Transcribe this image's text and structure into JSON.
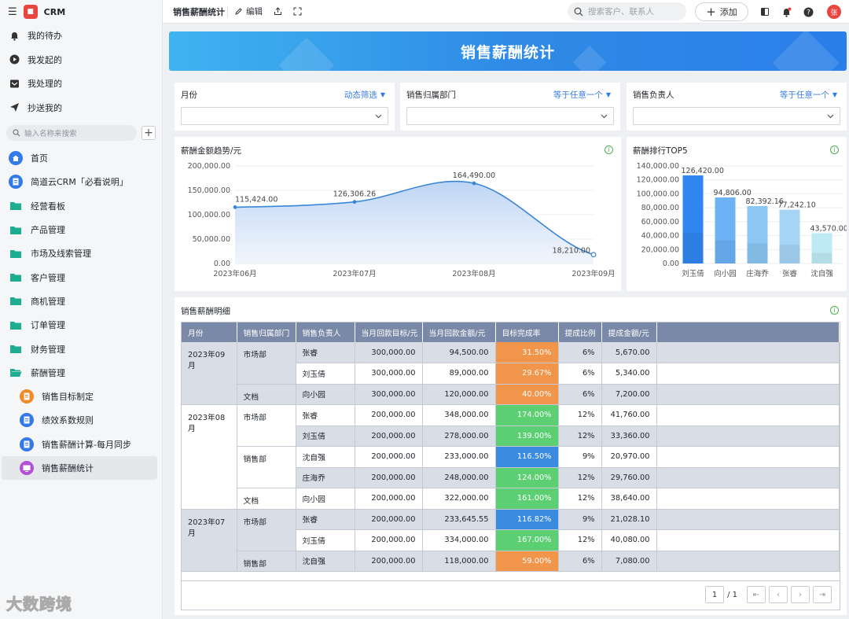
{
  "app": {
    "name": "CRM",
    "logo_color": "#e9453f"
  },
  "sidebar": {
    "quick": [
      {
        "label": "我的待办",
        "icon": "bell-icon"
      },
      {
        "label": "我发起的",
        "icon": "play-icon"
      },
      {
        "label": "我处理的",
        "icon": "inbox-icon"
      },
      {
        "label": "抄送我的",
        "icon": "send-icon"
      }
    ],
    "search_placeholder": "输入名称来搜索",
    "nav": [
      {
        "label": "首页",
        "icon": "home-icon"
      },
      {
        "label": "简道云CRM「必看说明」",
        "icon": "doc-icon"
      },
      {
        "label": "经营看板",
        "icon": "folder-icon"
      },
      {
        "label": "产品管理",
        "icon": "folder-icon"
      },
      {
        "label": "市场及线索管理",
        "icon": "folder-icon"
      },
      {
        "label": "客户管理",
        "icon": "folder-icon"
      },
      {
        "label": "商机管理",
        "icon": "folder-icon"
      },
      {
        "label": "订单管理",
        "icon": "folder-icon"
      },
      {
        "label": "财务管理",
        "icon": "folder-icon"
      },
      {
        "label": "薪酬管理",
        "icon": "folder-open-icon"
      }
    ],
    "sub": [
      {
        "label": "销售目标制定",
        "icon": "form-icon",
        "color": "#f08a24"
      },
      {
        "label": "绩效系数规则",
        "icon": "form-icon",
        "color": "#3479e8"
      },
      {
        "label": "销售薪酬计算-每月同步",
        "icon": "form-icon",
        "color": "#3479e8"
      },
      {
        "label": "销售薪酬统计",
        "icon": "dashboard-icon",
        "color": "#b14fd6"
      }
    ]
  },
  "topbar": {
    "title": "销售薪酬统计",
    "edit": "编辑",
    "search_placeholder": "搜索客户、联系人",
    "add": "添加",
    "avatar": "张"
  },
  "banner": {
    "title": "销售薪酬统计"
  },
  "filters": [
    {
      "label": "月份",
      "op": "动态筛选"
    },
    {
      "label": "销售归属部门",
      "op": "等于任意一个"
    },
    {
      "label": "销售负责人",
      "op": "等于任意一个"
    }
  ],
  "trend": {
    "title": "薪酬金额趋势/元"
  },
  "top5": {
    "title": "薪酬排行TOP5"
  },
  "detail": {
    "title": "销售薪酬明细",
    "page": "1",
    "total_pages": "/ 1"
  },
  "chart_data": [
    {
      "type": "area",
      "title": "薪酬金额趋势/元",
      "categories": [
        "2023年06月",
        "2023年07月",
        "2023年08月",
        "2023年09月"
      ],
      "values": [
        115424,
        126306.26,
        164490,
        18210
      ],
      "value_labels": [
        "115,424.00",
        "126,306.26",
        "164,490.00",
        "18,210.00"
      ],
      "yticks": [
        "200,000.00",
        "150,000.00",
        "100,000.00",
        "50,000.00",
        "0.00"
      ],
      "ylim": [
        0,
        200000
      ],
      "color": "#3a86d8"
    },
    {
      "type": "bar",
      "title": "薪酬排行TOP5",
      "categories": [
        "刘玉倩",
        "向小园",
        "庄海乔",
        "张睿",
        "沈自强"
      ],
      "values": [
        126420,
        94806,
        82392.16,
        77242.1,
        43570
      ],
      "value_labels": [
        "126,420.00",
        "94,806.00",
        "82,392.16",
        "77,242.10",
        "43,570.00"
      ],
      "yticks": [
        "140,000.00",
        "120,000.00",
        "100,000.00",
        "80,000.00",
        "60,000.00",
        "40,000.00",
        "20,000.00",
        "0.00"
      ],
      "ylim": [
        0,
        140000
      ],
      "colors": [
        "#2f86f0",
        "#6cb2f5",
        "#8cc6f2",
        "#a5d4f5",
        "#bfeaf5"
      ]
    },
    {
      "type": "table",
      "columns": [
        "月份",
        "销售归属部门",
        "销售负责人",
        "当月回款目标/元",
        "当月回款金额/元",
        "目标完成率",
        "提成比例",
        "提成金额/元"
      ],
      "rows": [
        {
          "month": "2023年09月",
          "dept": "市场部",
          "owner": "张睿",
          "target": "300,000.00",
          "amount": "94,500.00",
          "rate": "31.50%",
          "rate_color": "#f0954a",
          "ratio": "6%",
          "commission": "5,670.00"
        },
        {
          "month": "",
          "dept": "",
          "owner": "刘玉倩",
          "target": "300,000.00",
          "amount": "89,000.00",
          "rate": "29.67%",
          "rate_color": "#f0954a",
          "ratio": "6%",
          "commission": "5,340.00"
        },
        {
          "month": "",
          "dept": "文档",
          "owner": "向小园",
          "target": "300,000.00",
          "amount": "120,000.00",
          "rate": "40.00%",
          "rate_color": "#f0954a",
          "ratio": "6%",
          "commission": "7,200.00"
        },
        {
          "month": "2023年08月",
          "dept": "市场部",
          "owner": "张睿",
          "target": "200,000.00",
          "amount": "348,000.00",
          "rate": "174.00%",
          "rate_color": "#5ccf73",
          "ratio": "12%",
          "commission": "41,760.00"
        },
        {
          "month": "",
          "dept": "",
          "owner": "刘玉倩",
          "target": "200,000.00",
          "amount": "278,000.00",
          "rate": "139.00%",
          "rate_color": "#5ccf73",
          "ratio": "12%",
          "commission": "33,360.00"
        },
        {
          "month": "",
          "dept": "销售部",
          "owner": "沈自强",
          "target": "200,000.00",
          "amount": "233,000.00",
          "rate": "116.50%",
          "rate_color": "#3a8be0",
          "ratio": "9%",
          "commission": "20,970.00"
        },
        {
          "month": "",
          "dept": "",
          "owner": "庄海乔",
          "target": "200,000.00",
          "amount": "248,000.00",
          "rate": "124.00%",
          "rate_color": "#5ccf73",
          "ratio": "12%",
          "commission": "29,760.00"
        },
        {
          "month": "",
          "dept": "文档",
          "owner": "向小园",
          "target": "200,000.00",
          "amount": "322,000.00",
          "rate": "161.00%",
          "rate_color": "#5ccf73",
          "ratio": "12%",
          "commission": "38,640.00"
        },
        {
          "month": "2023年07月",
          "dept": "市场部",
          "owner": "张睿",
          "target": "200,000.00",
          "amount": "233,645.55",
          "rate": "116.82%",
          "rate_color": "#3a8be0",
          "ratio": "9%",
          "commission": "21,028.10"
        },
        {
          "month": "",
          "dept": "",
          "owner": "刘玉倩",
          "target": "200,000.00",
          "amount": "334,000.00",
          "rate": "167.00%",
          "rate_color": "#5ccf73",
          "ratio": "12%",
          "commission": "40,080.00"
        },
        {
          "month": "",
          "dept": "销售部",
          "owner": "沈自强",
          "target": "200,000.00",
          "amount": "118,000.00",
          "rate": "59.00%",
          "rate_color": "#f0954a",
          "ratio": "6%",
          "commission": "7,080.00"
        }
      ]
    }
  ],
  "watermark": "大数跨境"
}
